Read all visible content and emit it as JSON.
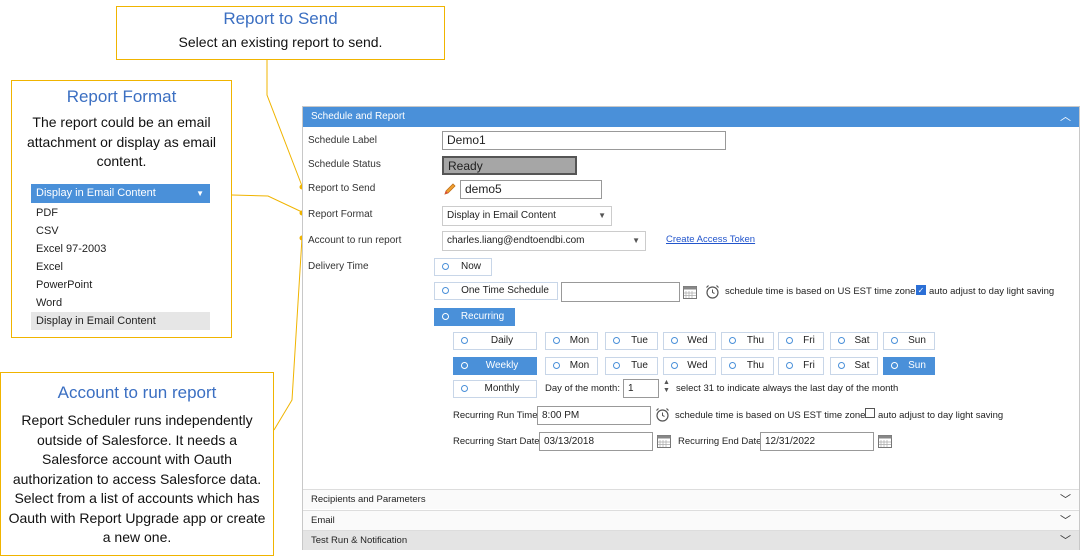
{
  "callouts": {
    "report_to_send": {
      "title": "Report to Send",
      "body": "Select an existing report to send."
    },
    "report_format": {
      "title": "Report Format",
      "body": "The report could be an email attachment or display as email content.",
      "dropdown_selected": "Display in Email Content",
      "options": [
        "PDF",
        "CSV",
        "Excel 97-2003",
        "Excel",
        "PowerPoint",
        "Word",
        "Display in Email Content"
      ]
    },
    "account": {
      "title": "Account to run report",
      "body": "Report Scheduler runs independently outside of Salesforce. It needs a Salesforce account with Oauth authorization to access Salesforce data. Select from a list of accounts which has Oauth with Report Upgrade app or create a new one."
    }
  },
  "panel": {
    "header": "Schedule and Report",
    "labels": {
      "schedule_label": "Schedule Label",
      "schedule_status": "Schedule Status",
      "report_to_send": "Report to Send",
      "report_format": "Report Format",
      "account": "Account to run report",
      "delivery_time": "Delivery Time"
    },
    "values": {
      "schedule_label": "Demo1",
      "schedule_status": "Ready",
      "report_to_send": "demo5",
      "report_format": "Display in Email Content",
      "account": "charles.liang@endtoendbi.com"
    },
    "create_token": "Create Access Token",
    "delivery": {
      "now": "Now",
      "one_time": "One Time Schedule",
      "one_time_note": "schedule time is based on US EST time zone.",
      "auto_adjust": "auto adjust to day light saving",
      "recurring": "Recurring",
      "daily": "Daily",
      "weekly": "Weekly",
      "monthly": "Monthly",
      "days": [
        "Mon",
        "Tue",
        "Wed",
        "Thu",
        "Fri",
        "Sat",
        "Sun"
      ],
      "day_of_month_label": "Day of the month:",
      "day_of_month_value": "1",
      "day_of_month_note": "select 31 to indicate always the last day of the month",
      "run_time_label": "Recurring Run Time",
      "run_time_value": "8:00 PM",
      "run_time_note": "schedule time is based on US EST time zone.",
      "auto_adjust2": "auto adjust to day light saving",
      "start_label": "Recurring Start Date",
      "start_value": "03/13/2018",
      "end_label": "Recurring End Date",
      "end_value": "12/31/2022"
    },
    "sections": [
      "Recipients and Parameters",
      "Email",
      "Test Run & Notification"
    ]
  },
  "colors": {
    "accent": "#4a90d9",
    "callout_border": "#f0b400",
    "callout_title": "#3b6fc2"
  }
}
